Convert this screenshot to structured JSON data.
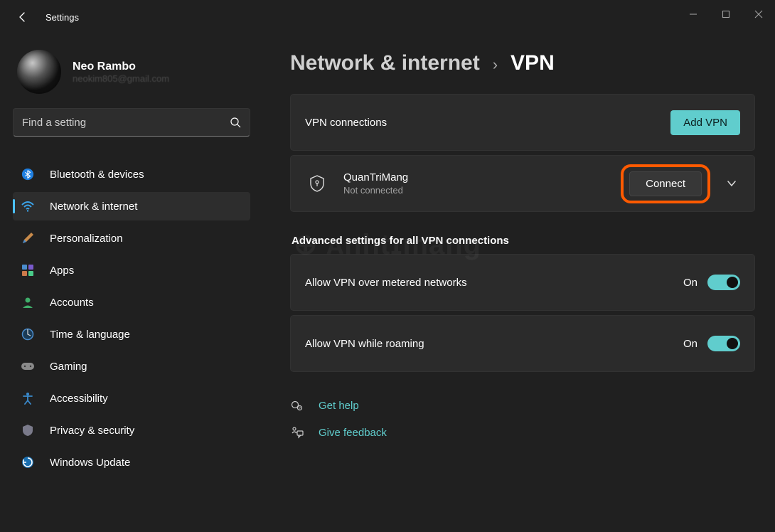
{
  "app": {
    "title": "Settings"
  },
  "profile": {
    "name": "Neo Rambo",
    "email": "neokim805@gmail.com"
  },
  "search": {
    "placeholder": "Find a setting"
  },
  "sidebar": {
    "items": [
      {
        "label": "Bluetooth & devices"
      },
      {
        "label": "Network & internet"
      },
      {
        "label": "Personalization"
      },
      {
        "label": "Apps"
      },
      {
        "label": "Accounts"
      },
      {
        "label": "Time & language"
      },
      {
        "label": "Gaming"
      },
      {
        "label": "Accessibility"
      },
      {
        "label": "Privacy & security"
      },
      {
        "label": "Windows Update"
      }
    ],
    "active_index": 1
  },
  "breadcrumb": {
    "parent": "Network & internet",
    "current": "VPN"
  },
  "vpn": {
    "section_label": "VPN connections",
    "add_button": "Add VPN",
    "connection": {
      "name": "QuanTriMang",
      "status": "Not connected",
      "connect_button": "Connect"
    }
  },
  "advanced": {
    "header": "Advanced settings for all VPN connections",
    "options": [
      {
        "label": "Allow VPN over metered networks",
        "state": "On",
        "on": true
      },
      {
        "label": "Allow VPN while roaming",
        "state": "On",
        "on": true
      }
    ]
  },
  "help": {
    "get_help": "Get help",
    "feedback": "Give feedback"
  },
  "colors": {
    "accent": "#60cdcd",
    "highlight": "#ff5a00"
  }
}
